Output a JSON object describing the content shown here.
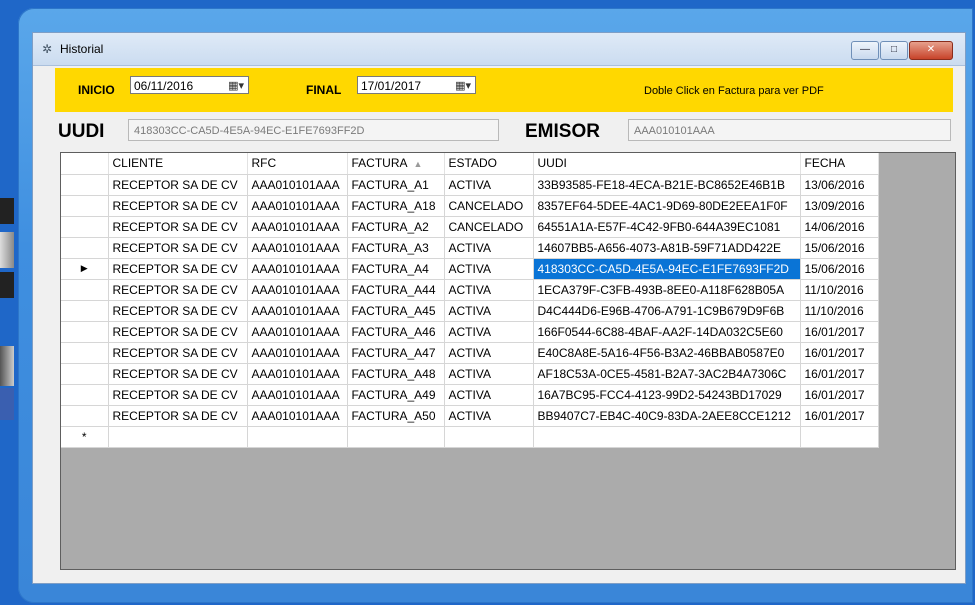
{
  "window": {
    "title": "Historial"
  },
  "toolbar": {
    "start_label": "INICIO",
    "start_date": "06/11/2016",
    "end_label": "FINAL",
    "end_date": "17/01/2017",
    "note": "Doble Click en Factura  para ver PDF"
  },
  "info": {
    "uudi_label": "UUDI",
    "uudi_value": "418303CC-CA5D-4E5A-94EC-E1FE7693FF2D",
    "emisor_label": "EMISOR",
    "emisor_value": "AAA010101AAA"
  },
  "grid": {
    "columns": [
      "CLIENTE",
      "RFC",
      "FACTURA",
      "ESTADO",
      "UUDI",
      "FECHA"
    ],
    "sorted_column": "FACTURA",
    "selected_row": 4,
    "rows": [
      [
        "RECEPTOR SA DE CV",
        "AAA010101AAA",
        "FACTURA_A1",
        "ACTIVA",
        "33B93585-FE18-4ECA-B21E-BC8652E46B1B",
        "13/06/2016"
      ],
      [
        "RECEPTOR SA DE CV",
        "AAA010101AAA",
        "FACTURA_A18",
        "CANCELADO",
        "8357EF64-5DEE-4AC1-9D69-80DE2EEA1F0F",
        "13/09/2016"
      ],
      [
        "RECEPTOR SA DE CV",
        "AAA010101AAA",
        "FACTURA_A2",
        "CANCELADO",
        "64551A1A-E57F-4C42-9FB0-644A39EC1081",
        "14/06/2016"
      ],
      [
        "RECEPTOR SA DE CV",
        "AAA010101AAA",
        "FACTURA_A3",
        "ACTIVA",
        "14607BB5-A656-4073-A81B-59F71ADD422E",
        "15/06/2016"
      ],
      [
        "RECEPTOR SA DE CV",
        "AAA010101AAA",
        "FACTURA_A4",
        "ACTIVA",
        "418303CC-CA5D-4E5A-94EC-E1FE7693FF2D",
        "15/06/2016"
      ],
      [
        "RECEPTOR SA DE CV",
        "AAA010101AAA",
        "FACTURA_A44",
        "ACTIVA",
        "1ECA379F-C3FB-493B-8EE0-A118F628B05A",
        "11/10/2016"
      ],
      [
        "RECEPTOR SA DE CV",
        "AAA010101AAA",
        "FACTURA_A45",
        "ACTIVA",
        "D4C444D6-E96B-4706-A791-1C9B679D9F6B",
        "11/10/2016"
      ],
      [
        "RECEPTOR SA DE CV",
        "AAA010101AAA",
        "FACTURA_A46",
        "ACTIVA",
        "166F0544-6C88-4BAF-AA2F-14DA032C5E60",
        "16/01/2017"
      ],
      [
        "RECEPTOR SA DE CV",
        "AAA010101AAA",
        "FACTURA_A47",
        "ACTIVA",
        "E40C8A8E-5A16-4F56-B3A2-46BBAB0587E0",
        "16/01/2017"
      ],
      [
        "RECEPTOR SA DE CV",
        "AAA010101AAA",
        "FACTURA_A48",
        "ACTIVA",
        "AF18C53A-0CE5-4581-B2A7-3AC2B4A7306C",
        "16/01/2017"
      ],
      [
        "RECEPTOR SA DE CV",
        "AAA010101AAA",
        "FACTURA_A49",
        "ACTIVA",
        "16A7BC95-FCC4-4123-99D2-54243BD17029",
        "16/01/2017"
      ],
      [
        "RECEPTOR SA DE CV",
        "AAA010101AAA",
        "FACTURA_A50",
        "ACTIVA",
        "BB9407C7-EB4C-40C9-83DA-2AEE8CCE1212",
        "16/01/2017"
      ]
    ],
    "new_row_marker": "*",
    "current_row_marker": "▶"
  },
  "colors": {
    "toolbar_bg": "#ffd800",
    "selection": "#0a74d6",
    "desktop": "#1f67c8"
  },
  "icons": [
    "app-icon",
    "calendar-icon",
    "minimize-icon",
    "maximize-icon",
    "close-icon"
  ]
}
